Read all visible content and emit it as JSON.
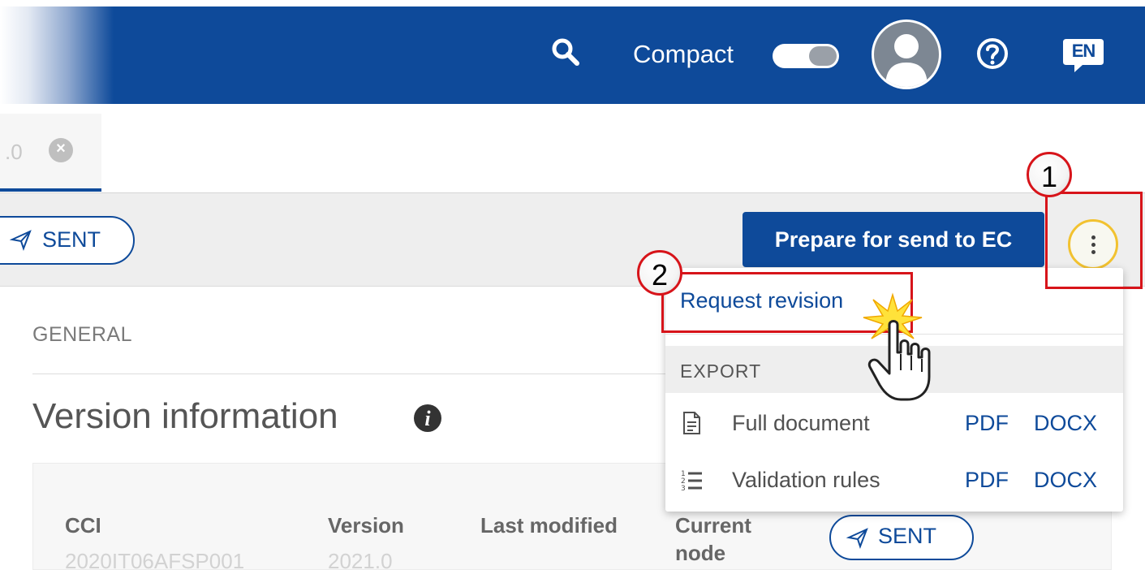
{
  "header": {
    "compact_label": "Compact",
    "language_label": "EN",
    "compact_toggle_on": false,
    "brand_color": "#0e4a9a",
    "icons": [
      "search-icon",
      "user-avatar-icon",
      "help-icon",
      "language-icon"
    ]
  },
  "tab": {
    "label": ".0",
    "close_icon": "close-icon"
  },
  "action_bar": {
    "status_label": "SENT",
    "primary_button": "Prepare for send to EC",
    "more_icon": "kebab-menu-icon"
  },
  "menu": {
    "request_revision": "Request revision",
    "export_heading": "EXPORT",
    "rows": [
      {
        "label": "Full document",
        "pdf": "PDF",
        "docx": "DOCX",
        "icon": "document-icon"
      },
      {
        "label": "Validation rules",
        "pdf": "PDF",
        "docx": "DOCX",
        "icon": "list-numbered-icon"
      }
    ]
  },
  "content": {
    "section_label": "GENERAL",
    "title": "Version information",
    "columns": {
      "cci": "CCI",
      "version": "Version",
      "last_modified": "Last modified",
      "current_node": "Current node"
    },
    "row_values": {
      "cci": "2020IT06AFSP001",
      "version": "2021.0"
    },
    "status_label": "SENT"
  },
  "callouts": {
    "step1": "1",
    "step2": "2",
    "highlight_color": "#d7141a"
  }
}
